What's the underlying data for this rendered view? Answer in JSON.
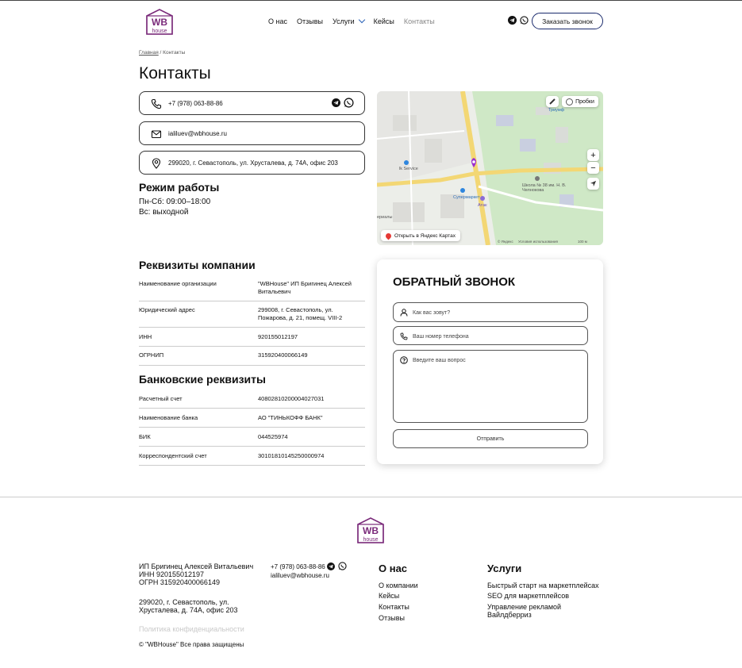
{
  "header": {
    "logo_text_top": "WB",
    "logo_text_bottom": "house",
    "nav": [
      "О нас",
      "Отзывы",
      "Услуги",
      "Кейсы",
      "Контакты"
    ],
    "call_button": "Заказать звонок",
    "social_icons": [
      "telegram-icon",
      "whatsapp-icon"
    ]
  },
  "breadcrumb": {
    "home": "Главная",
    "sep": " / ",
    "current": "Контакты"
  },
  "page_title": "Контакты",
  "contacts": {
    "phone": "+7 (978) 063-88-86",
    "email": "ialiluev@wbhouse.ru",
    "address": "299020, г. Севастополь, ул. Хрусталева, д. 74А, офис 203"
  },
  "schedule": {
    "title": "Режим работы",
    "line1": "Пн-Сб: 09:00–18:00",
    "line2": "Вс: выходной"
  },
  "map": {
    "traffic": "Пробки",
    "open_link": "Открыть в Яндекс Картах",
    "zoom_in": "+",
    "zoom_out": "−",
    "labels": {
      "supermarket": "Супермаркет",
      "ataj": "Атак",
      "school": "Школа № 38 им. Н. В. Челнокова",
      "service": "lk Service",
      "triumph": "Триумф",
      "final": "ериалы",
      "yandex": "© Яндекс",
      "terms": "Условия использования",
      "scale": "100 м"
    }
  },
  "requisites": {
    "title": "Реквизиты компании",
    "rows": [
      {
        "k": "Наименование организации",
        "v": "\"WBHouse\" ИП Бригинец Алексей Витальевич"
      },
      {
        "k": "Юридический адрес",
        "v": "299008, г. Севастополь, ул. Пожарова, д. 21, помещ. VIII-2"
      },
      {
        "k": "ИНН",
        "v": "920155012197"
      },
      {
        "k": "ОГРНИП",
        "v": "315920400066149"
      }
    ]
  },
  "bank": {
    "title": "Банковские реквизиты",
    "rows": [
      {
        "k": "Расчетный счет",
        "v": "40802810200004027031"
      },
      {
        "k": "Наименование банка",
        "v": "АО \"ТИНЬКОФФ БАНК\""
      },
      {
        "k": "БИК",
        "v": "044525974"
      },
      {
        "k": "Корреспондентский счет",
        "v": "30101810145250000974"
      }
    ]
  },
  "form": {
    "title": "ОБРАТНЫЙ ЗВОНОК",
    "name_placeholder": "Как вас зовут?",
    "phone_placeholder": "Ваш номер телефона",
    "question_placeholder": "Введите ваш вопрос",
    "submit": "Отправить"
  },
  "footer": {
    "company": "ИП Бригинец Алексей Витальевич",
    "inn": "ИНН 920155012197",
    "ogrn": "ОГРН 315920400066149",
    "address1": "299020, г. Севастополь, ул.",
    "address2": "Хрусталева, д. 74А, офис 203",
    "privacy": "Политика конфиденциальности",
    "copyright": "© \"WBHouse\" Все права защищены",
    "phone": "+7 (978) 063-88-86",
    "email": "ialiluev@wbhouse.ru",
    "about_title": "О нас",
    "about_links": [
      "О компании",
      "Кейсы",
      "Контакты",
      "Отзывы"
    ],
    "services_title": "Услуги",
    "services_links": [
      "Быстрый старт на маркетплейсах",
      "SEO для маркетплейсов",
      "Управление рекламой",
      "Вайлдберриз"
    ]
  },
  "colors": {
    "brand": "#7a2a7a",
    "accent": "#1a2a6c",
    "muted": "#c9c9c9"
  }
}
